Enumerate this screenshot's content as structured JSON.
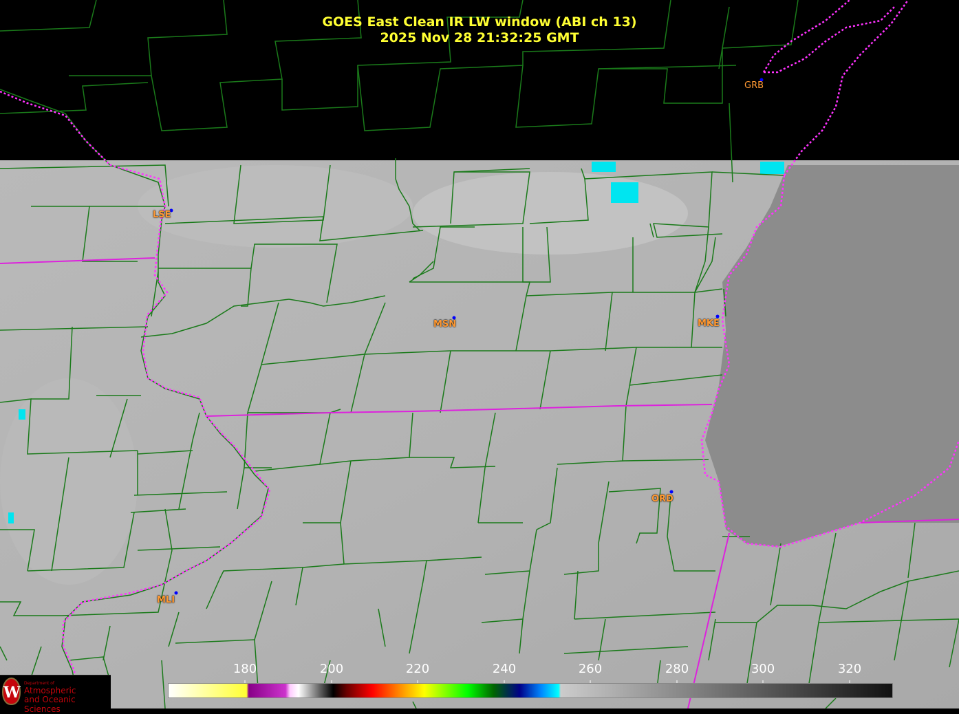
{
  "title": {
    "line1": "GOES East Clean IR LW window (ABI ch 13)",
    "line2": "2025 Nov 28  21:32:25 GMT"
  },
  "stations": [
    {
      "code": "GRB"
    },
    {
      "code": "LSE"
    },
    {
      "code": "MSN"
    },
    {
      "code": "MKE"
    },
    {
      "code": "ORD"
    },
    {
      "code": "MLI"
    }
  ],
  "colorbar": {
    "ticks": [
      "180",
      "200",
      "220",
      "240",
      "260",
      "280",
      "300",
      "320"
    ],
    "range": [
      163,
      330
    ],
    "colors": {
      "warm_gray_start": "#ffffff",
      "cold_yellow": "#ffff33",
      "magenta": "#cc33cc",
      "red": "#ff0000",
      "green": "#00ff00",
      "blue": "#000088",
      "cyan": "#00ffff"
    }
  },
  "colors": {
    "county_lines": "#1a7a1a",
    "state_lines": "#ff33ff",
    "title": "#ffff33",
    "station_label": "#ff9933",
    "station_dot": "#0000ff"
  },
  "logo": {
    "small": "Department of",
    "line1": "Atmospheric",
    "line2": "and Oceanic Sciences"
  }
}
